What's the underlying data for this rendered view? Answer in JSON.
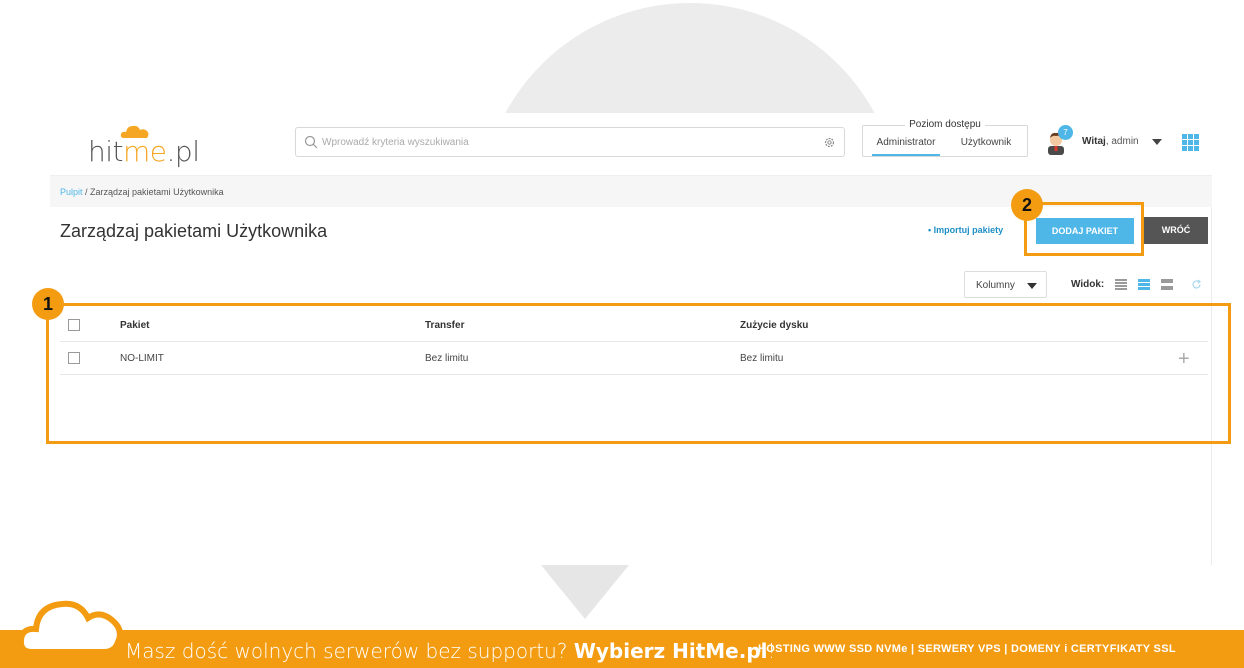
{
  "header": {
    "logo": {
      "part1": "hit",
      "part2": "me",
      "part3": ".pl"
    },
    "search": {
      "placeholder": "Wprowadź kryteria wyszukiwania"
    },
    "access": {
      "title": "Poziom dostępu",
      "admin_label": "Administrator",
      "user_label": "Użytkownik",
      "selected": "Administrator"
    },
    "user": {
      "notifications": "7",
      "greet_bold": "Witaj",
      "greet_rest": ", admin"
    }
  },
  "breadcrumb": {
    "home": "Pulpit",
    "separator": " / ",
    "current": "Zarządzaj pakietami Użytkownika"
  },
  "page": {
    "title": "Zarządzaj pakietami Użytkownika",
    "import_link": "• Importuj pakiety",
    "add_button": "DODAJ PAKIET",
    "back_button": "WRÓĆ",
    "columns_button": "Kolumny",
    "view_label": "Widok:"
  },
  "table": {
    "columns": [
      "Pakiet",
      "Transfer",
      "Zużycie dysku"
    ],
    "rows": [
      {
        "package": "NO-LIMIT",
        "transfer": "Bez limitu",
        "disk": "Bez limitu"
      }
    ]
  },
  "annotations": {
    "label1": "1",
    "label2": "2",
    "color": "#f39c12"
  },
  "footer": {
    "text_light": "Masz dość wolnych serwerów bez supportu? ",
    "text_bold": "Wybierz HitMe.pl",
    "text_end": "!",
    "right": "HOSTING WWW SSD NVMe | SERWERY VPS | DOMENY i CERTYFIKATY SSL"
  },
  "colors": {
    "accent": "#4fb7e8",
    "orange": "#f39c12",
    "dark_button": "#555555"
  }
}
